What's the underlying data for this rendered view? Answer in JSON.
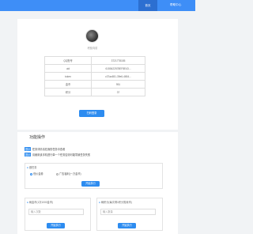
{
  "nav": {
    "items": [
      "首页",
      "帮助中心"
    ]
  },
  "profile": {
    "username": "积极向前"
  },
  "info_rows": [
    {
      "key": "QQ账号",
      "value": "3721778185"
    },
    {
      "key": "uid",
      "value": "6155422578EF8E43..."
    },
    {
      "key": "token",
      "value": "c37ac651-39e6-4654..."
    },
    {
      "key": "金币",
      "value": "951"
    },
    {
      "key": "积分",
      "value": "37"
    }
  ],
  "login_button": "扫码登录",
  "ops": {
    "title": "功能操作",
    "tips": [
      {
        "tag": "提示",
        "text": "任务详情请在我的任务中查看"
      },
      {
        "tag": "提示",
        "text": "请使用该手机进行单一个任务否则可能导致任务失败"
      }
    ],
    "task_panel": {
      "title": "做任务",
      "options": [
        "低价金券",
        "广告福利(一万金币)"
      ],
      "selected": 0,
      "button": "开始执行"
    },
    "gold_panel": {
      "title": "刷金币(1次1000金币)",
      "placeholder": "输入次数",
      "button": "开始执行"
    },
    "points_panel": {
      "title": "刷积分(每次得1积分需卖币)",
      "placeholder": "输入数量",
      "button": "开始执行"
    }
  }
}
